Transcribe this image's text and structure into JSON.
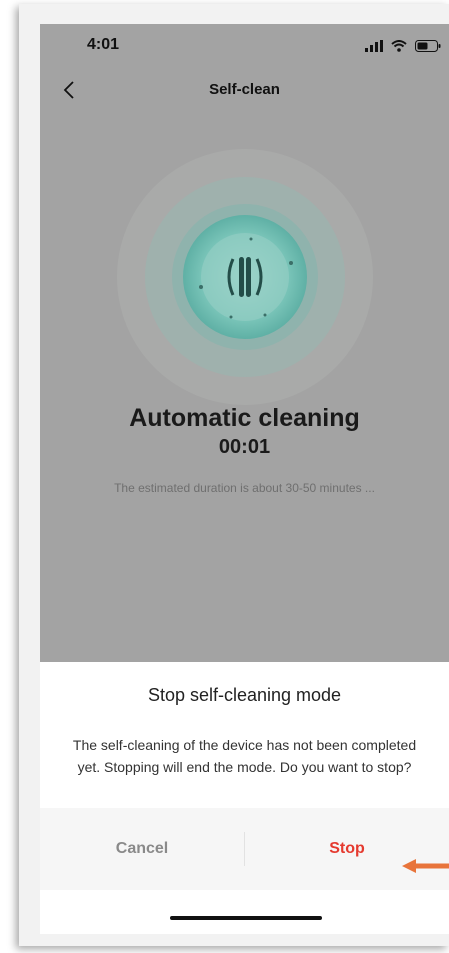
{
  "status_bar": {
    "time": "4:01",
    "icons": [
      "signal-icon",
      "wifi-icon",
      "battery-icon"
    ]
  },
  "nav": {
    "title": "Self-clean",
    "back_icon": "chevron-left-icon"
  },
  "cleaning": {
    "mode_title": "Automatic cleaning",
    "timer": "00:01",
    "estimate": "The estimated duration is about 30-50 minutes ..."
  },
  "dialog": {
    "title": "Stop self-cleaning mode",
    "message": "The self-cleaning of the device has not been completed yet. Stopping will end the mode. Do you want to stop?",
    "cancel_label": "Cancel",
    "stop_label": "Stop"
  },
  "colors": {
    "overlay": "#a3a3a3",
    "accent_teal": "#8fd3c8",
    "stop_red": "#e53a2f",
    "annotation_arrow": "#e8743b"
  }
}
